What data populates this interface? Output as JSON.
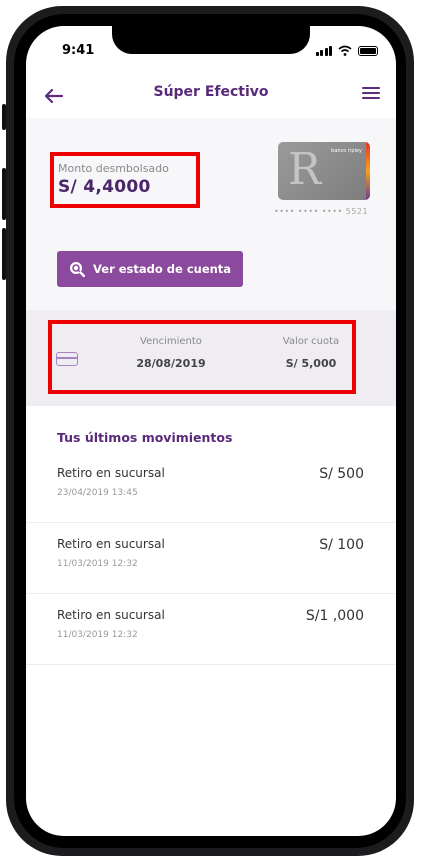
{
  "status_bar": {
    "time": "9:41"
  },
  "header": {
    "title": "Súper Efectivo",
    "back_icon": "arrow-left-icon",
    "menu_icon": "hamburger-menu-icon"
  },
  "summary": {
    "amount_label": "Monto desmbolsado",
    "amount_value": "S/ 4,4000",
    "card_brand": "banco ripley",
    "card_letter": "R",
    "card_masked_number": "•••• •••• •••• 5521",
    "statement_button_label": "Ver estado de cuenta"
  },
  "due": {
    "due_date_label": "Vencimiento",
    "due_date_value": "28/08/2019",
    "installment_label": "Valor cuota",
    "installment_value": "S/ 5,000"
  },
  "movements": {
    "title": "Tus últimos movimientos",
    "items": [
      {
        "description": "Retiro en sucursal",
        "date": "23/04/2019 13:45",
        "amount": "S/ 500"
      },
      {
        "description": "Retiro en sucursal",
        "date": "11/03/2019 12:32",
        "amount": "S/ 100"
      },
      {
        "description": "Retiro en sucursal",
        "date": "11/03/2019 12:32",
        "amount": "S/1 ,000"
      }
    ]
  },
  "colors": {
    "brand_purple": "#5a2a7a",
    "button_purple": "#8b4a9e",
    "highlight_red": "#ee0000"
  }
}
